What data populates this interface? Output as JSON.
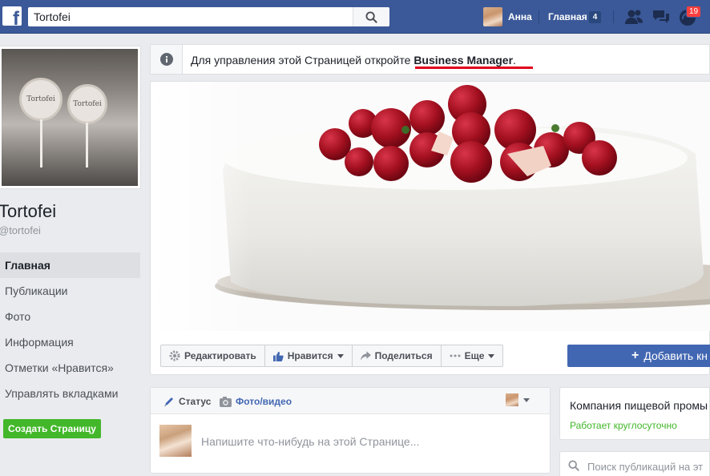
{
  "topbar": {
    "logo": "f",
    "search_value": "Tortofei",
    "search_icon": "search-icon",
    "user_name": "Анна",
    "home_label": "Главная",
    "home_badge": "4",
    "notifications_count": "19",
    "bar_color": "#3b5998"
  },
  "notice": {
    "text": "Для управления этой Страницей откройте ",
    "link": "Business Manager",
    "suffix": ".",
    "highlight_color": "#e0001b"
  },
  "cover": {
    "image": "strawberry-cake-photo",
    "actions": {
      "edit": "Редактировать",
      "like": "Нравится",
      "share": "Поделиться",
      "more": "Еще"
    },
    "add_button": "Добавить кн"
  },
  "page": {
    "name": "Tortofei",
    "handle": "@tortofei",
    "profile_logo": "Tortofei"
  },
  "nav": {
    "items": [
      {
        "label": "Главная",
        "active": true
      },
      {
        "label": "Публикации"
      },
      {
        "label": "Фото"
      },
      {
        "label": "Информация"
      },
      {
        "label": "Отметки «Нравится»"
      },
      {
        "label": "Управлять вкладками"
      }
    ],
    "create_page": "Создать Страницу"
  },
  "composer": {
    "tab_status": "Статус",
    "tab_photo": "Фото/видео",
    "placeholder": "Напишите что-нибудь на этой Странице..."
  },
  "about": {
    "category": "Компания пищевой промы",
    "hours": "Работает круглосуточно"
  },
  "page_search": {
    "placeholder": "Поиск публикаций на эт"
  }
}
